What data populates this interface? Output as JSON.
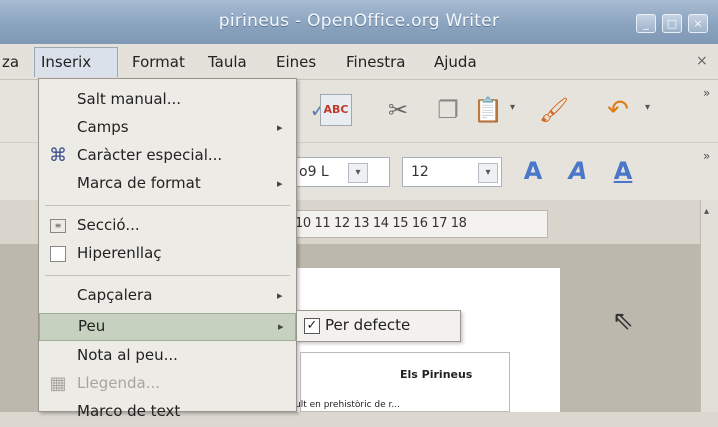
{
  "window": {
    "title": "pirineus - OpenOffice.org Writer",
    "controls": [
      "_",
      "□",
      "×"
    ]
  },
  "menubar": {
    "items": [
      {
        "label": "za"
      },
      {
        "label": "Inserix"
      },
      {
        "label": "Format"
      },
      {
        "label": "Taula"
      },
      {
        "label": "Eines"
      },
      {
        "label": "Finestra"
      },
      {
        "label": "Ajuda"
      }
    ],
    "close_glyph": "×"
  },
  "toolbar": {
    "font_name": "o9 L",
    "font_size": "12",
    "overflow": "»"
  },
  "ruler": {
    "numbers": "10 11 12 13 14 15 16 17 18"
  },
  "insert_menu": {
    "items": [
      {
        "label": "Salt manual...",
        "submenu": false,
        "enabled": true
      },
      {
        "label": "Camps",
        "submenu": true,
        "enabled": true
      },
      {
        "label": "Caràcter especial...",
        "submenu": false,
        "enabled": true,
        "icon": "omega-icon"
      },
      {
        "label": "Marca de format",
        "submenu": true,
        "enabled": true
      },
      {
        "label": "Secció...",
        "submenu": false,
        "enabled": true,
        "icon": "section-icon"
      },
      {
        "label": "Hiperenllaç",
        "submenu": false,
        "enabled": true,
        "icon": "hyperlink-icon"
      },
      {
        "label": "Capçalera",
        "submenu": true,
        "enabled": true
      },
      {
        "label": "Peu",
        "submenu": true,
        "enabled": true,
        "highlighted": true
      },
      {
        "label": "Nota al peu...",
        "submenu": false,
        "enabled": true
      },
      {
        "label": "Llegenda...",
        "submenu": false,
        "enabled": false,
        "icon": "caption-icon"
      },
      {
        "label": "Marco de text",
        "submenu": false,
        "enabled": true
      }
    ],
    "arrow_glyph": "▸"
  },
  "peu_submenu": {
    "items": [
      {
        "label": "Per defecte",
        "checked": true
      }
    ]
  },
  "document": {
    "heading": "Els Pirineus",
    "body_text": "ult en prehistòric de r..."
  },
  "colors": {
    "titlebar": "#8aa3bf",
    "highlight": "#c6d2bf",
    "menu_bg": "#edebe6"
  }
}
